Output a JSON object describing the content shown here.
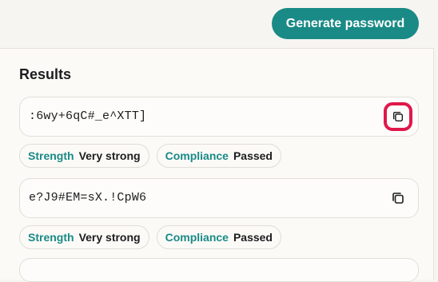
{
  "colors": {
    "accent": "#1a8a86",
    "focus_ring": "#e0174a"
  },
  "header": {
    "generate_label": "Generate password"
  },
  "results": {
    "title": "Results",
    "items": [
      {
        "password": ":6wy+6qC#_e^XTT]",
        "copy_icon": "copy-icon",
        "strength_label": "Strength",
        "strength_value": "Very strong",
        "compliance_label": "Compliance",
        "compliance_value": "Passed",
        "copy_focused": true
      },
      {
        "password": "e?J9#EM=sX.!CpW6",
        "copy_icon": "copy-icon",
        "strength_label": "Strength",
        "strength_value": "Very strong",
        "compliance_label": "Compliance",
        "compliance_value": "Passed",
        "copy_focused": false
      }
    ]
  }
}
